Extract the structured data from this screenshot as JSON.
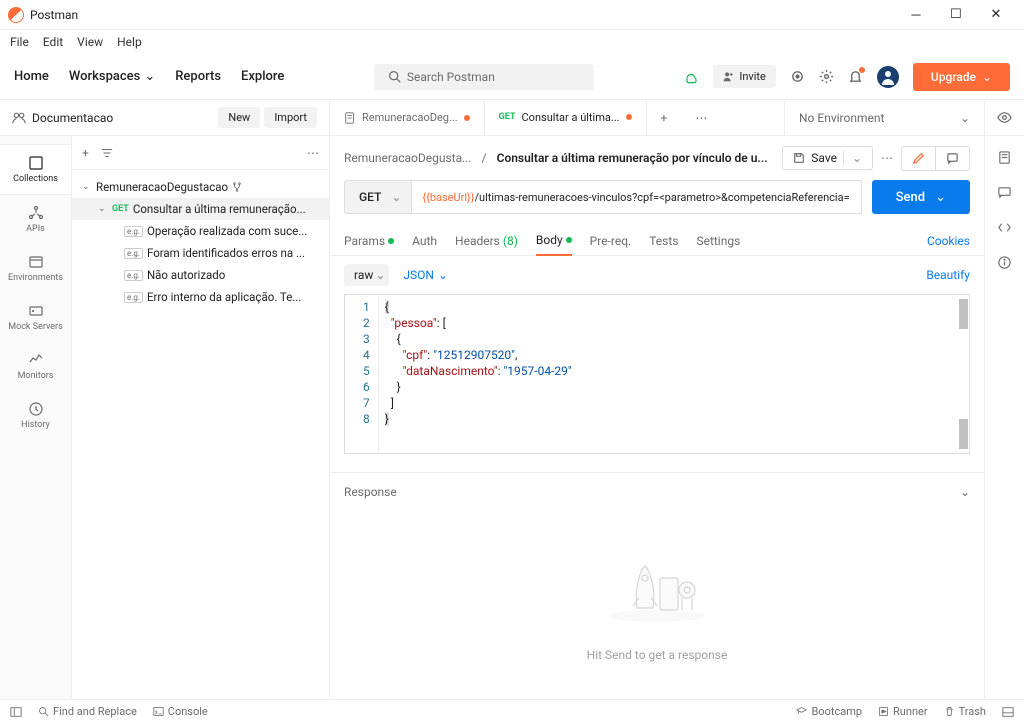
{
  "app": {
    "title": "Postman"
  },
  "menu": {
    "file": "File",
    "edit": "Edit",
    "view": "View",
    "help": "Help"
  },
  "nav": {
    "home": "Home",
    "workspaces": "Workspaces",
    "reports": "Reports",
    "explore": "Explore"
  },
  "search": {
    "placeholder": "Search Postman"
  },
  "invite": "Invite",
  "upgrade": "Upgrade",
  "workspace": {
    "name": "Documentacao",
    "new": "New",
    "import": "Import"
  },
  "tabs": [
    {
      "label": "RemuneracaoDeg...",
      "modified": true,
      "method": ""
    },
    {
      "label": "Consultar a última...",
      "modified": true,
      "method": "GET"
    }
  ],
  "tabplus": "+",
  "env": {
    "label": "No Environment"
  },
  "rail": {
    "collections": "Collections",
    "apis": "APIs",
    "environments": "Environments",
    "mock": "Mock Servers",
    "monitors": "Monitors",
    "history": "History"
  },
  "tree": {
    "collection": "RemuneracaoDegustacao",
    "request": {
      "method": "GET",
      "name": "Consultar a última remuneração..."
    },
    "examples": [
      "Operação realizada com suce...",
      "Foram identificados erros na ...",
      "Não autorizado",
      "Erro interno da aplicação. Te..."
    ]
  },
  "breadcrumb": {
    "p1": "RemuneracaoDegusta...",
    "sep": "/",
    "p2": "Consultar a última remuneração por vínculo de u..."
  },
  "save": "Save",
  "request": {
    "method": "GET",
    "urlvar": "{{baseUrl}}",
    "urlpath": "/ultimas-remuneracoes-vinculos?cpf=<parametro>&competenciaReferencia=",
    "send": "Send"
  },
  "reqtabs": {
    "params": "Params",
    "auth": "Auth",
    "headers": "Headers",
    "hcount": "(8)",
    "body": "Body",
    "prereq": "Pre-req.",
    "tests": "Tests",
    "settings": "Settings",
    "cookies": "Cookies"
  },
  "bodybar": {
    "raw": "raw",
    "json": "JSON",
    "beautify": "Beautify"
  },
  "code": {
    "l1": "{",
    "l2k": "\"pessoa\"",
    "l2r": ": [",
    "l3": "{",
    "l4k": "\"cpf\"",
    "l4v": "\"12512907520\"",
    "l5k": "\"dataNascimento\"",
    "l5v": "\"1957-04-29\"",
    "l6": "}",
    "l7": "]",
    "l8": "}"
  },
  "lines": [
    "1",
    "2",
    "3",
    "4",
    "5",
    "6",
    "7",
    "8"
  ],
  "response": {
    "title": "Response",
    "empty": "Hit Send to get a response"
  },
  "status": {
    "find": "Find and Replace",
    "console": "Console",
    "bootcamp": "Bootcamp",
    "runner": "Runner",
    "trash": "Trash"
  }
}
